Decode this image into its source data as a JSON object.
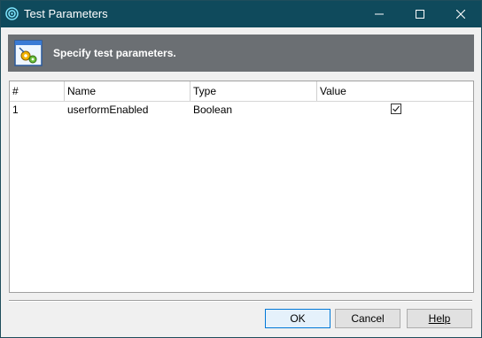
{
  "window": {
    "title": "Test Parameters"
  },
  "header": {
    "text": "Specify test parameters."
  },
  "grid": {
    "columns": [
      "#",
      "Name",
      "Type",
      "Value"
    ],
    "rows": [
      {
        "index": "1",
        "name": "userformEnabled",
        "type": "Boolean",
        "value_checked": true
      }
    ]
  },
  "buttons": {
    "ok": "OK",
    "cancel": "Cancel",
    "help": "Help"
  },
  "colors": {
    "titlebar": "#0f4a5c",
    "header": "#6b6f73",
    "default_button_border": "#0078d7"
  },
  "icons": [
    "app-icon",
    "minimize-icon",
    "maximize-icon",
    "close-icon",
    "parameters-icon",
    "checkmark-icon"
  ]
}
